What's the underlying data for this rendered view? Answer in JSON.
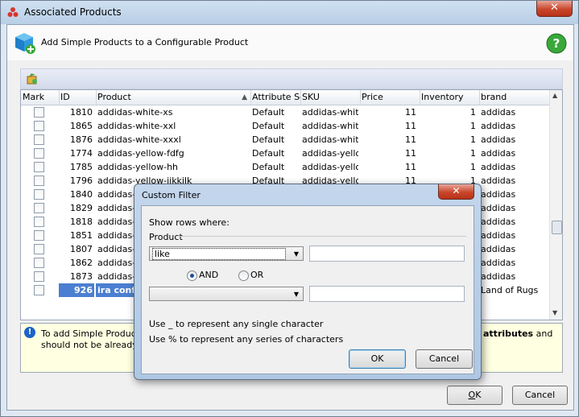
{
  "window": {
    "title": "Associated Products",
    "close_glyph": "✕"
  },
  "header": {
    "text": "Add Simple Products to a Configurable Product",
    "icon": "cube-add-icon",
    "help_icon": "help-icon"
  },
  "grid": {
    "columns": [
      "Mark",
      "ID",
      "Product",
      "Attribute Se",
      "SKU",
      "Price",
      "Inventory",
      "brand"
    ],
    "sort_indicator": "▲",
    "rows": [
      {
        "id": "1810",
        "product": "addidas-white-xs",
        "attr": "Default",
        "sku": "addidas-white-",
        "price": "11",
        "inv": "1",
        "brand": "addidas"
      },
      {
        "id": "1865",
        "product": "addidas-white-xxl",
        "attr": "Default",
        "sku": "addidas-white-",
        "price": "11",
        "inv": "1",
        "brand": "addidas"
      },
      {
        "id": "1876",
        "product": "addidas-white-xxxl",
        "attr": "Default",
        "sku": "addidas-white-",
        "price": "11",
        "inv": "1",
        "brand": "addidas"
      },
      {
        "id": "1774",
        "product": "addidas-yellow-fdfg",
        "attr": "Default",
        "sku": "addidas-yellow",
        "price": "11",
        "inv": "1",
        "brand": "addidas"
      },
      {
        "id": "1785",
        "product": "addidas-yellow-hh",
        "attr": "Default",
        "sku": "addidas-yellow",
        "price": "11",
        "inv": "1",
        "brand": "addidas"
      },
      {
        "id": "1796",
        "product": "addidas-yellow-jjkkjlk",
        "attr": "Default",
        "sku": "addidas-yellow",
        "price": "11",
        "inv": "1",
        "brand": "addidas"
      },
      {
        "id": "1840",
        "product": "addidas-y",
        "attr": "",
        "sku": "",
        "price": "",
        "inv": "",
        "brand": "addidas"
      },
      {
        "id": "1829",
        "product": "addidas-y",
        "attr": "",
        "sku": "",
        "price": "",
        "inv": "",
        "brand": "addidas"
      },
      {
        "id": "1818",
        "product": "addidas-y",
        "attr": "",
        "sku": "",
        "price": "",
        "inv": "",
        "brand": "addidas"
      },
      {
        "id": "1851",
        "product": "addidas-y",
        "attr": "",
        "sku": "",
        "price": "",
        "inv": "",
        "brand": "addidas"
      },
      {
        "id": "1807",
        "product": "addidas-y",
        "attr": "",
        "sku": "",
        "price": "",
        "inv": "",
        "brand": "addidas"
      },
      {
        "id": "1862",
        "product": "addidas-y",
        "attr": "",
        "sku": "",
        "price": "",
        "inv": "",
        "brand": "addidas"
      },
      {
        "id": "1873",
        "product": "addidas-y",
        "attr": "",
        "sku": "",
        "price": "",
        "inv": "",
        "brand": "addidas"
      },
      {
        "id": "926",
        "product": "ira confi",
        "attr": "",
        "sku": "",
        "price": "",
        "inv": "",
        "brand": "Land of Rugs"
      }
    ]
  },
  "info": {
    "line1": "To add Simple Products t",
    "line1_right_bold": "attributes",
    "line1_right_rest": " and",
    "line2": "should not be already lis"
  },
  "buttons": {
    "ok": "OK",
    "ok_hotkey": "O",
    "ok_rest": "K",
    "cancel": "Cancel"
  },
  "dialog": {
    "title": "Custom Filter",
    "show_rows": "Show rows where:",
    "field": "Product",
    "operator1": "like",
    "and_label": "AND",
    "or_label": "OR",
    "hint1": "Use _ to represent any single character",
    "hint2": "Use % to represent any series of characters",
    "ok": "OK",
    "cancel": "Cancel"
  }
}
